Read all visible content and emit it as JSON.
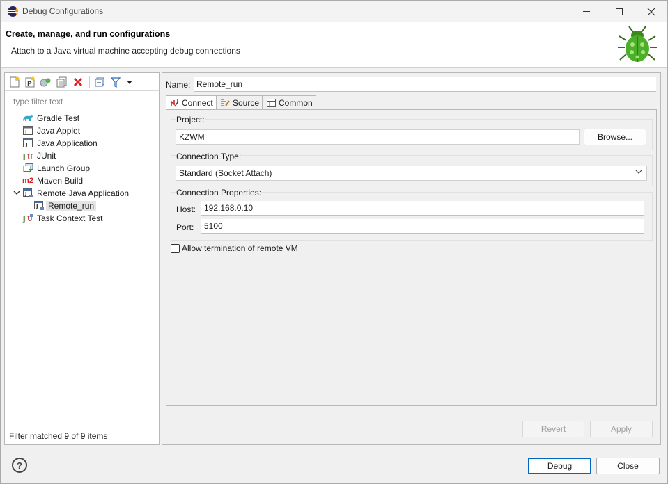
{
  "window": {
    "title": "Debug Configurations"
  },
  "header": {
    "title": "Create, manage, and run configurations",
    "subtitle": "Attach to a Java virtual machine accepting debug connections",
    "icon": "bug-icon"
  },
  "left": {
    "toolbar": {
      "buttons": [
        "new-launch-configuration-icon",
        "new-prototype-icon",
        "export-icon",
        "duplicate-icon",
        "delete-icon",
        "collapse-all-icon",
        "filter-icon",
        "view-menu-icon"
      ]
    },
    "filter_placeholder": "type filter text",
    "tree": [
      {
        "label": "Gradle Test",
        "icon": "gradle-icon"
      },
      {
        "label": "Java Applet",
        "icon": "java-applet-icon"
      },
      {
        "label": "Java Application",
        "icon": "java-application-icon"
      },
      {
        "label": "JUnit",
        "icon": "junit-icon"
      },
      {
        "label": "Launch Group",
        "icon": "launch-group-icon"
      },
      {
        "label": "Maven Build",
        "icon": "maven-icon"
      },
      {
        "label": "Remote Java Application",
        "icon": "remote-java-icon",
        "expanded": true
      },
      {
        "label": "Remote_run",
        "icon": "remote-run-icon",
        "selected": true
      },
      {
        "label": "Task Context Test",
        "icon": "task-context-icon"
      }
    ],
    "status": "Filter matched 9 of 9 items"
  },
  "right": {
    "name_label": "Name:",
    "name_value": "Remote_run",
    "tabs": [
      {
        "label": "Connect",
        "icon": "connect-icon",
        "active": true
      },
      {
        "label": "Source",
        "icon": "source-icon"
      },
      {
        "label": "Common",
        "icon": "common-icon"
      }
    ],
    "project": {
      "group_label": "Project:",
      "value": "KZWM",
      "browse_label": "Browse..."
    },
    "connection_type": {
      "group_label": "Connection Type:",
      "selected": "Standard (Socket Attach)"
    },
    "connection_properties": {
      "group_label": "Connection Properties:",
      "host_label": "Host:",
      "host_value": "192.168.0.10",
      "port_label": "Port:",
      "port_value": "5100"
    },
    "allow_termination": {
      "label": "Allow termination of remote VM",
      "checked": false
    },
    "revert_label": "Revert",
    "apply_label": "Apply"
  },
  "footer": {
    "debug_label": "Debug",
    "close_label": "Close",
    "help_icon": "help-icon"
  },
  "colors": {
    "accent": "#0067c0",
    "maven_red": "#d42020",
    "delete_red": "#e02020",
    "bug_green": "#4caf2a"
  }
}
